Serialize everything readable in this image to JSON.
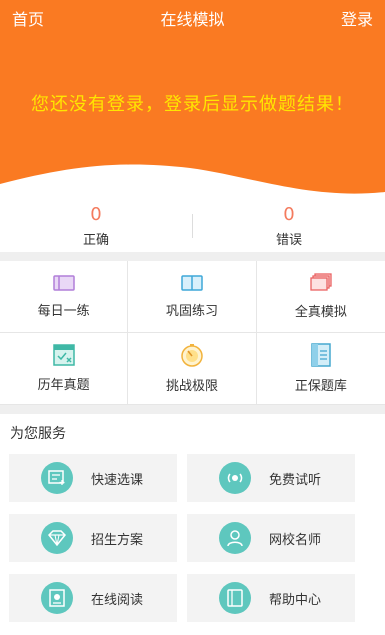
{
  "header": {
    "home_label": "首页",
    "title": "在线模拟",
    "login_label": "登录"
  },
  "hero": {
    "message": "您还没有登录，登录后显示做题结果！"
  },
  "stats": {
    "correct": {
      "value": "0",
      "label": "正确"
    },
    "wrong": {
      "value": "0",
      "label": "错误"
    }
  },
  "menu": [
    {
      "label": "每日一练",
      "icon": "calendar-icon"
    },
    {
      "label": "巩固练习",
      "icon": "book-icon"
    },
    {
      "label": "全真模拟",
      "icon": "stacked-papers-icon"
    },
    {
      "label": "历年真题",
      "icon": "exam-sheet-icon"
    },
    {
      "label": "挑战极限",
      "icon": "stopwatch-icon"
    },
    {
      "label": "正保题库",
      "icon": "question-bank-icon"
    }
  ],
  "services": {
    "title": "为您服务",
    "items": [
      {
        "label": "快速选课",
        "icon": "course-select-icon"
      },
      {
        "label": "免费试听",
        "icon": "audio-play-icon"
      },
      {
        "label": "招生方案",
        "icon": "diamond-icon"
      },
      {
        "label": "网校名师",
        "icon": "teacher-icon"
      },
      {
        "label": "在线阅读",
        "icon": "reading-icon"
      },
      {
        "label": "帮助中心",
        "icon": "help-book-icon"
      }
    ]
  },
  "colors": {
    "primary": "#fa7a22",
    "hero_text": "#ffe600",
    "stat_number": "#f47b5e",
    "service_icon_bg": "#5ec7be"
  }
}
